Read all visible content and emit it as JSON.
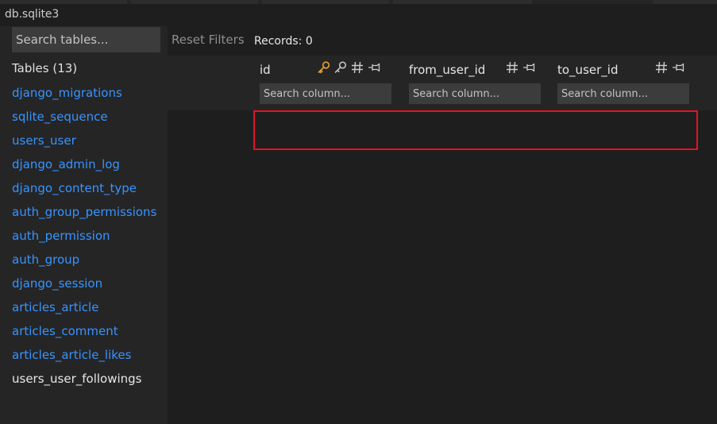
{
  "window": {
    "title": "db.sqlite3"
  },
  "sidebar": {
    "search_placeholder": "Search tables...",
    "tables_header": "Tables (13)",
    "tables": [
      "django_migrations",
      "sqlite_sequence",
      "users_user",
      "django_admin_log",
      "django_content_type",
      "auth_group_permissions",
      "auth_permission",
      "auth_group",
      "django_session",
      "articles_article",
      "articles_comment",
      "articles_article_likes",
      "users_user_followings"
    ],
    "active_table": "users_user_followings"
  },
  "toolbar": {
    "reset_filters_label": "Reset Filters",
    "records_label": "Records: 0"
  },
  "columns": [
    {
      "name": "id",
      "search_placeholder": "Search column...",
      "icons": [
        "primary-key-icon",
        "key-icon",
        "number-type-icon",
        "pin-icon"
      ]
    },
    {
      "name": "from_user_id",
      "search_placeholder": "Search column...",
      "icons": [
        "number-type-icon",
        "pin-icon"
      ]
    },
    {
      "name": "to_user_id",
      "search_placeholder": "Search column...",
      "icons": [
        "number-type-icon",
        "pin-icon"
      ]
    }
  ],
  "colors": {
    "background": "#1e1e1e",
    "sidebar": "#252526",
    "input": "#3c3c3c",
    "link": "#3794ff",
    "primary_key": "#e8a435",
    "highlight": "#e81123"
  }
}
